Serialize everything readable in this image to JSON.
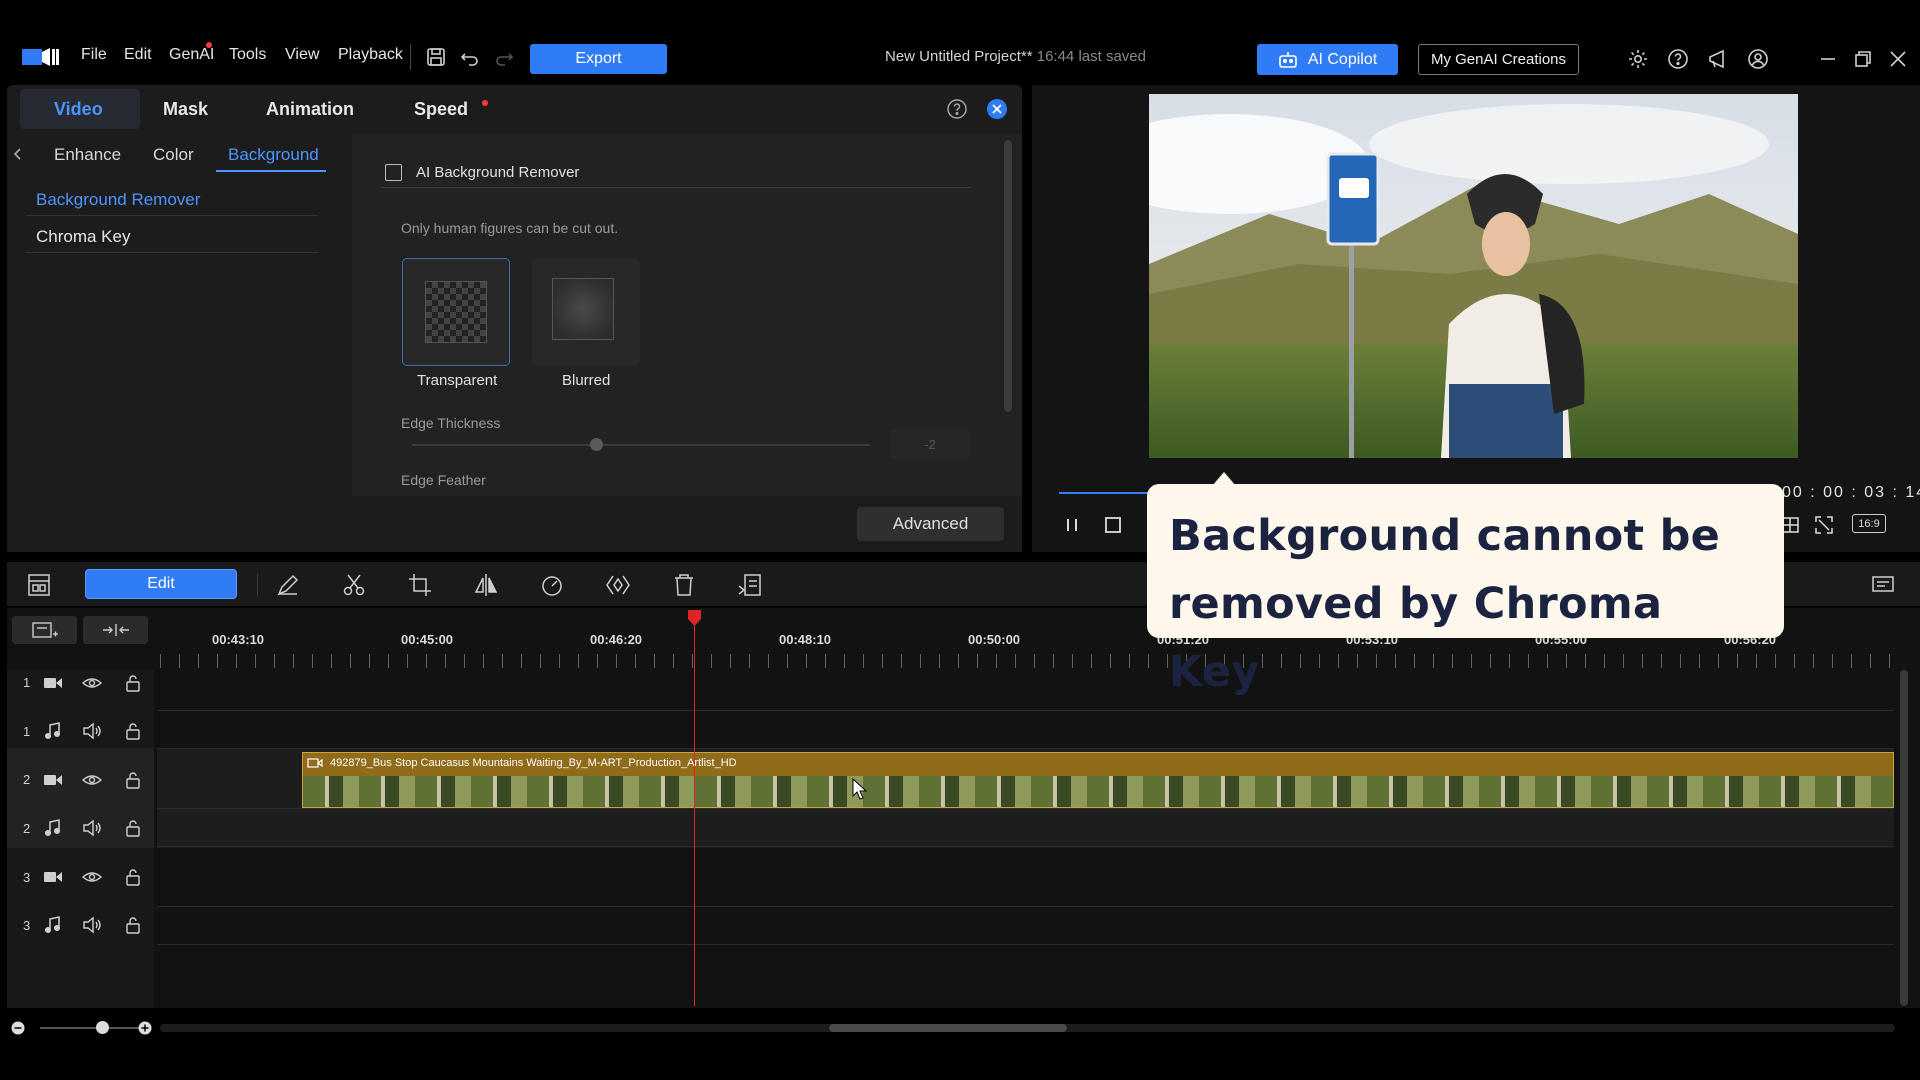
{
  "menu": {
    "items": [
      "File",
      "Edit",
      "GenAI",
      "Tools",
      "View",
      "Playback"
    ],
    "export_label": "Export"
  },
  "project": {
    "title": "New Untitled Project**",
    "saved": "16:44 last saved"
  },
  "header_right": {
    "copilot_label": "AI Copilot",
    "creations_label": "My GenAI Creations"
  },
  "panel": {
    "tabs": [
      "Video",
      "Mask",
      "Animation",
      "Speed"
    ],
    "active_tab": "Video",
    "subtabs": [
      "Enhance",
      "Color",
      "Background"
    ],
    "active_subtab": "Background",
    "side_items": [
      "Background Remover",
      "Chroma Key"
    ],
    "ai_remover_label": "AI Background Remover",
    "ai_remover_checked": false,
    "note": "Only human figures can be cut out.",
    "options": [
      "Transparent",
      "Blurred"
    ],
    "edge_thickness_label": "Edge Thickness",
    "edge_thickness_value": "-2",
    "edge_feather_label": "Edge Feather",
    "advanced_label": "Advanced"
  },
  "preview": {
    "timecode": "00 : 00 : 03 : 14",
    "aspect": "16:9",
    "progress": 0.08
  },
  "timeline": {
    "edit_label": "Edit",
    "ruler_labels": [
      "00:43:10",
      "00:45:00",
      "00:46:20",
      "00:48:10",
      "00:50:00",
      "00:51:20",
      "00:53:10",
      "00:55:00",
      "00:56:20"
    ],
    "tracks": [
      "1",
      "1",
      "2",
      "2",
      "3",
      "3"
    ],
    "clip_title": "492879_Bus Stop Caucasus Mountains Waiting_By_M-ART_Production_Artlist_HD"
  },
  "callout": {
    "line1": "Background cannot be",
    "line2": "removed by Chroma Key"
  },
  "colors": {
    "accent": "#2f7cf6",
    "active_text": "#4d95ff",
    "playhead": "#e02424",
    "clip": "#8f6b1a"
  }
}
